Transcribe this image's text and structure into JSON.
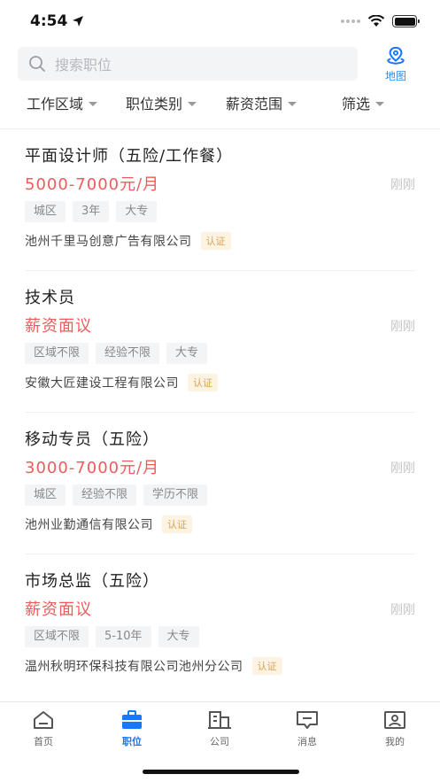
{
  "status_bar": {
    "time": "4:54"
  },
  "search": {
    "placeholder": "搜索职位"
  },
  "map_button": {
    "label": "地图"
  },
  "filters": [
    {
      "label": "工作区域"
    },
    {
      "label": "职位类别"
    },
    {
      "label": "薪资范围"
    },
    {
      "label": "筛选"
    }
  ],
  "jobs": [
    {
      "title": "平面设计师（五险/工作餐）",
      "salary": "5000-7000元/月",
      "time": "刚刚",
      "tags": [
        "城区",
        "3年",
        "大专"
      ],
      "company": "池州千里马创意广告有限公司",
      "badge": "认证"
    },
    {
      "title": "技术员",
      "salary": "薪资面议",
      "time": "刚刚",
      "tags": [
        "区域不限",
        "经验不限",
        "大专"
      ],
      "company": "安徽大匠建设工程有限公司",
      "badge": "认证"
    },
    {
      "title": "移动专员（五险）",
      "salary": "3000-7000元/月",
      "time": "刚刚",
      "tags": [
        "城区",
        "经验不限",
        "学历不限"
      ],
      "company": "池州业勤通信有限公司",
      "badge": "认证"
    },
    {
      "title": "市场总监（五险）",
      "salary": "薪资面议",
      "time": "刚刚",
      "tags": [
        "区域不限",
        "5-10年",
        "大专"
      ],
      "company": "温州秋明环保科技有限公司池州分公司",
      "badge": "认证"
    }
  ],
  "tab_bar": [
    {
      "label": "首页",
      "icon": "home-icon",
      "active": false
    },
    {
      "label": "职位",
      "icon": "briefcase-icon",
      "active": true
    },
    {
      "label": "公司",
      "icon": "building-icon",
      "active": false
    },
    {
      "label": "消息",
      "icon": "message-icon",
      "active": false
    },
    {
      "label": "我的",
      "icon": "profile-icon",
      "active": false
    }
  ],
  "colors": {
    "accent": "#1677ff",
    "salary": "#ee5b5b",
    "badge": "#d9a25a"
  }
}
